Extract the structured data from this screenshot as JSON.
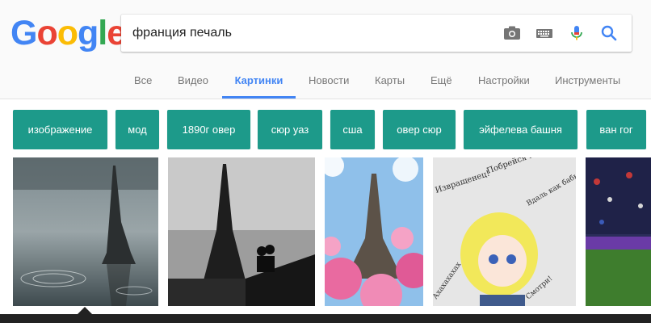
{
  "logo": {
    "letters": [
      "G",
      "o",
      "o",
      "g",
      "l",
      "e"
    ],
    "colors": [
      "#4285f4",
      "#ea4335",
      "#fbbc05",
      "#4285f4",
      "#34a853",
      "#ea4335"
    ]
  },
  "search": {
    "query": "франция печаль"
  },
  "tabs": [
    {
      "label": "Все"
    },
    {
      "label": "Видео"
    },
    {
      "label": "Картинки",
      "active": true
    },
    {
      "label": "Новости"
    },
    {
      "label": "Карты"
    },
    {
      "label": "Ещё"
    },
    {
      "label": "Настройки"
    },
    {
      "label": "Инструменты"
    }
  ],
  "chips": [
    {
      "label": "изображение"
    },
    {
      "label": "мод"
    },
    {
      "label": "1890г овер"
    },
    {
      "label": "сюр уаз"
    },
    {
      "label": "сша"
    },
    {
      "label": "овер сюр"
    },
    {
      "label": "эйфелева башня"
    },
    {
      "label": "ван гог"
    }
  ],
  "thumbnails": [
    {
      "subject": "eiffel-tower-rain-reflection"
    },
    {
      "subject": "eiffel-tower-couple-bw"
    },
    {
      "subject": "eiffel-tower-cherry-blossoms"
    },
    {
      "subject": "anime-girl-crying-sketch",
      "captions": [
        "Побрейся пойди..",
        "Извращенец!",
        "Вдаль как бабы",
        "Ахахахахах",
        "Смотри!"
      ]
    },
    {
      "subject": "football-stadium"
    }
  ],
  "colors": {
    "accent": "#4285f4",
    "chip": "#1d9a8a",
    "tab_inactive": "#777777"
  },
  "icons": [
    "camera-icon",
    "keyboard-icon",
    "microphone-icon",
    "search-icon"
  ]
}
